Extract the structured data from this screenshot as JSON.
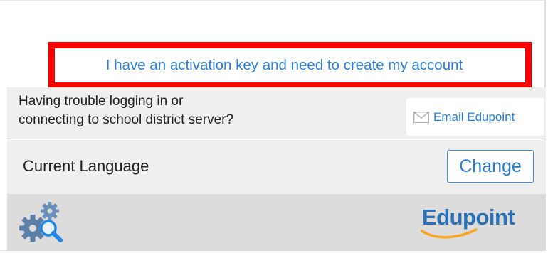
{
  "activation": {
    "link_label": "I have an activation key and need to create my account",
    "highlight_color": "#ff0000"
  },
  "trouble": {
    "line1": "Having trouble logging in or",
    "line2": "connecting to school district server?",
    "email_button_label": "Email Edupoint",
    "email_icon": "envelope-icon"
  },
  "language": {
    "label": "Current Language",
    "change_button_label": "Change"
  },
  "footer": {
    "settings_icon": "gears-search-icon",
    "brand_name": "Edupoint",
    "brand_trademark": "·"
  },
  "colors": {
    "link": "#2a7fd4",
    "panel": "#efefef",
    "footer": "#dcdcdc",
    "brand": "#2b6fb6",
    "icon_gear": "#5b7fa8",
    "icon_accent": "#1e88e5"
  }
}
